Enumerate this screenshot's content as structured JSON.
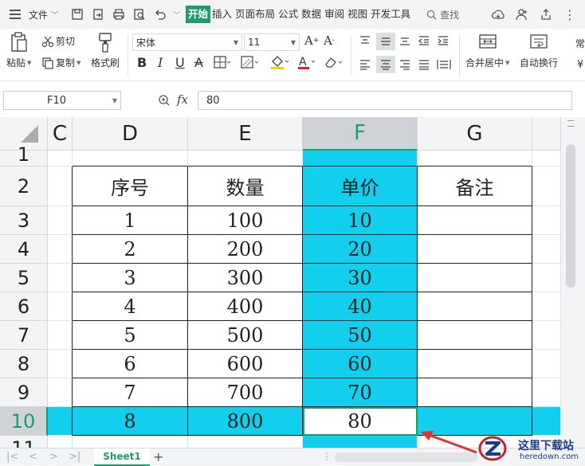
{
  "menubar": {
    "file_label": "文件",
    "tabs": [
      {
        "label": "开始",
        "active": true
      },
      {
        "label": "插入"
      },
      {
        "label": "页面布局"
      },
      {
        "label": "公式"
      },
      {
        "label": "数据"
      },
      {
        "label": "审阅"
      },
      {
        "label": "视图"
      },
      {
        "label": "开发工具"
      }
    ],
    "search_label": "查找"
  },
  "ribbon": {
    "paste_label": "粘贴",
    "cut_label": "剪切",
    "copy_label": "复制",
    "format_painter_label": "格式刷",
    "font_name": "宋体",
    "font_size": "11",
    "merge_center_label": "合并居中",
    "wrap_text_label": "自动换行",
    "overflow_label": "常",
    "currency_symbol": "¥"
  },
  "formula_bar": {
    "name_box": "F10",
    "fx_label": "fx",
    "formula": "80"
  },
  "grid": {
    "columns": [
      "C",
      "D",
      "E",
      "F",
      "G"
    ],
    "selected_column": "F",
    "rows": [
      "1",
      "2",
      "3",
      "4",
      "5",
      "6",
      "7",
      "8",
      "9",
      "10",
      "11"
    ],
    "selected_row": "10",
    "headers": [
      "序号",
      "数量",
      "单价",
      "备注"
    ],
    "data": [
      [
        "1",
        "100",
        "10",
        ""
      ],
      [
        "2",
        "200",
        "20",
        ""
      ],
      [
        "3",
        "300",
        "30",
        ""
      ],
      [
        "4",
        "400",
        "40",
        ""
      ],
      [
        "5",
        "500",
        "50",
        ""
      ],
      [
        "6",
        "600",
        "60",
        ""
      ],
      [
        "7",
        "700",
        "70",
        ""
      ],
      [
        "8",
        "800",
        "80",
        ""
      ]
    ],
    "highlight_color": "#12cfee",
    "accent_color": "#1e9c6e"
  },
  "sheets": [
    {
      "label": "Sheet1",
      "active": true
    }
  ],
  "watermark": {
    "title": "这里下载站",
    "domain": "heredown.com"
  }
}
